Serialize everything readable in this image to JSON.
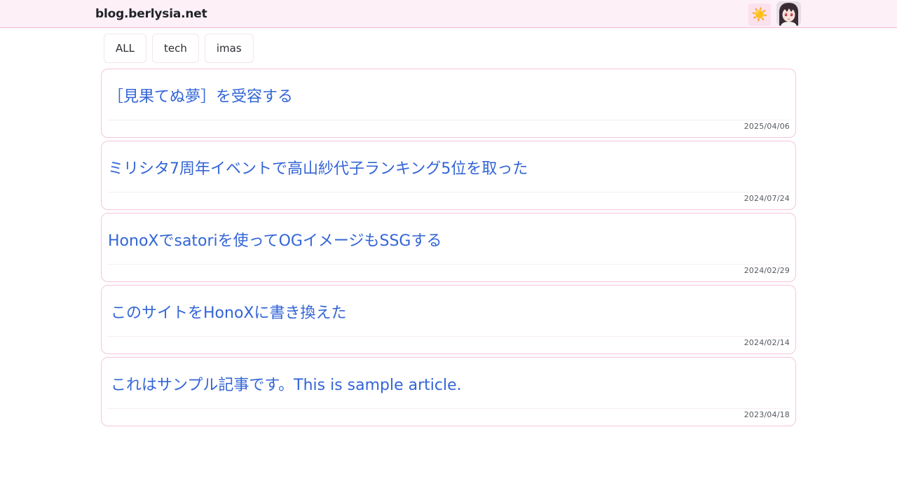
{
  "header": {
    "site_title": "blog.berlysia.net",
    "theme_icon": "sun-icon",
    "avatar_icon": "avatar-icon"
  },
  "tags": [
    {
      "label": "ALL"
    },
    {
      "label": "tech"
    },
    {
      "label": "imas"
    }
  ],
  "articles": [
    {
      "title": "［見果てぬ夢］を受容する",
      "date": "2025/04/06"
    },
    {
      "title": "ミリシタ7周年イベントで高山紗代子ランキング5位を取った",
      "date": "2024/07/24"
    },
    {
      "title": "HonoXでsatoriを使ってOGイメージもSSGする",
      "date": "2024/02/29"
    },
    {
      "title": "このサイトをHonoXに書き換えた",
      "date": "2024/02/14"
    },
    {
      "title": "これはサンプル記事です。This is sample article.",
      "date": "2023/04/18"
    }
  ],
  "colors": {
    "header_bg": "#fdf0f6",
    "accent_border": "#f6c4dc",
    "link": "#3365d6"
  }
}
